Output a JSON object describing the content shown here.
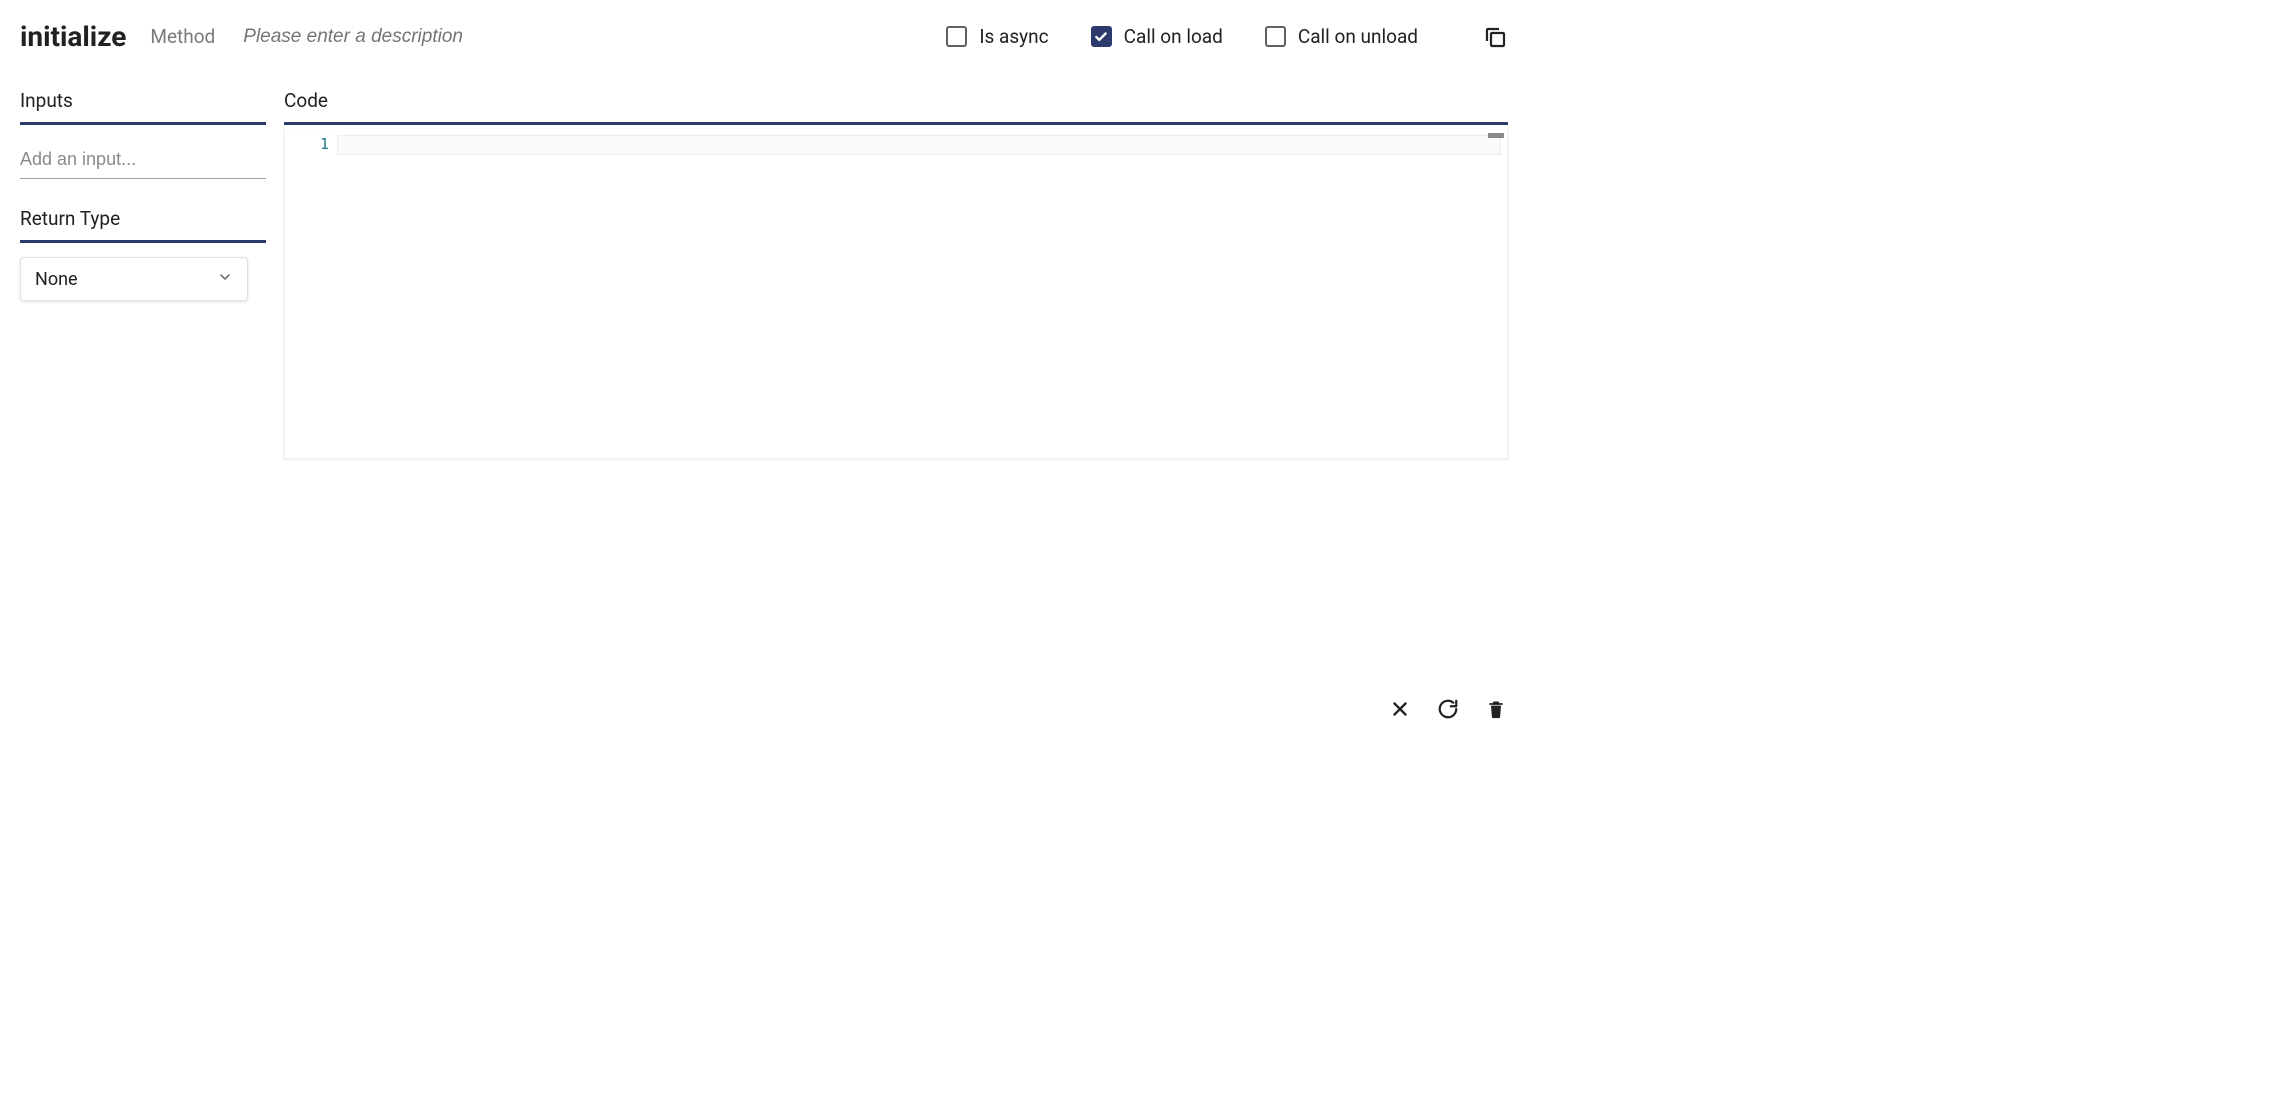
{
  "header": {
    "method_name": "initialize",
    "method_type_label": "Method",
    "description_placeholder": "Please enter a description",
    "checkboxes": {
      "is_async": {
        "label": "Is async",
        "checked": false
      },
      "call_on_load": {
        "label": "Call on load",
        "checked": true
      },
      "call_on_unload": {
        "label": "Call on unload",
        "checked": false
      }
    }
  },
  "sidebar": {
    "inputs_heading": "Inputs",
    "add_input_placeholder": "Add an input...",
    "return_type_heading": "Return Type",
    "return_type_value": "None"
  },
  "code": {
    "heading": "Code",
    "gutter_lines": [
      "1"
    ],
    "content": ""
  },
  "colors": {
    "accent": "#2d3a6e"
  }
}
